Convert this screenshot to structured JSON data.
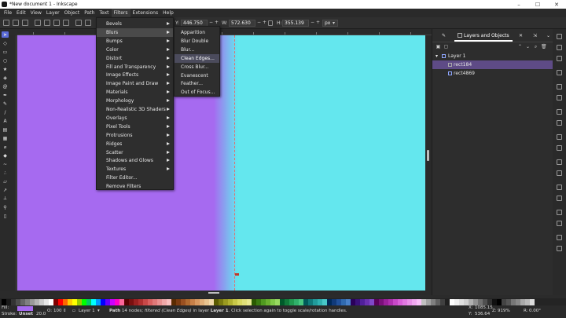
{
  "app": {
    "window_title": "*New document 1 - Inkscape",
    "window_controls": {
      "minimize": "–",
      "maximize": "☐",
      "close": "✕"
    }
  },
  "menubar": {
    "items": [
      {
        "label": "File"
      },
      {
        "label": "Edit"
      },
      {
        "label": "View"
      },
      {
        "label": "Layer"
      },
      {
        "label": "Object"
      },
      {
        "label": "Path"
      },
      {
        "label": "Text"
      },
      {
        "label": "Filters"
      },
      {
        "label": "Extensions"
      },
      {
        "label": "Help"
      }
    ]
  },
  "toolbar": {
    "y_label": "Y:",
    "y_value": "446.750",
    "w_label": "W:",
    "w_value": "572.630",
    "h_label": "H:",
    "h_value": "355.139",
    "units": "px",
    "minus": "−",
    "plus": "+"
  },
  "filters_menu": {
    "items": [
      {
        "label": "Bevels",
        "sub": true
      },
      {
        "label": "Blurs",
        "sub": true
      },
      {
        "label": "Bumps",
        "sub": true
      },
      {
        "label": "Color",
        "sub": true
      },
      {
        "label": "Distort",
        "sub": true
      },
      {
        "label": "Fill and Transparency",
        "sub": true
      },
      {
        "label": "Image Effects",
        "sub": true
      },
      {
        "label": "Image Paint and Draw",
        "sub": true
      },
      {
        "label": "Materials",
        "sub": true
      },
      {
        "label": "Morphology",
        "sub": true
      },
      {
        "label": "Non-Realistic 3D Shaders",
        "sub": true
      },
      {
        "label": "Overlays",
        "sub": true
      },
      {
        "label": "Pixel Tools",
        "sub": true
      },
      {
        "label": "Protrusions",
        "sub": true
      },
      {
        "label": "Ridges",
        "sub": true
      },
      {
        "label": "Scatter",
        "sub": true
      },
      {
        "label": "Shadows and Glows",
        "sub": true
      },
      {
        "label": "Textures",
        "sub": true
      },
      {
        "label": "Filter Editor...",
        "sub": false
      },
      {
        "label": "Remove Filters",
        "sub": false
      }
    ]
  },
  "blurs_submenu": {
    "items": [
      {
        "label": "Apparition"
      },
      {
        "label": "Blur Double"
      },
      {
        "label": "Blur..."
      },
      {
        "label": "Clean Edges..."
      },
      {
        "label": "Cross Blur..."
      },
      {
        "label": "Evanescent"
      },
      {
        "label": "Feather..."
      },
      {
        "label": "Out of Focus..."
      }
    ]
  },
  "panel": {
    "tab_label": "Layers and Objects",
    "tree": [
      {
        "label": "Layer 1"
      },
      {
        "label": "rect184"
      },
      {
        "label": "rect4869"
      }
    ]
  },
  "status": {
    "fill_label": "Fill:",
    "stroke_label": "Stroke:",
    "stroke_value": "Unset",
    "stroke_width": "20.0",
    "opacity_label": "O:",
    "opacity_value": "100",
    "layer_value": "Layer 1",
    "message_bold": "Path",
    "message_a": " 14 nodes; ",
    "message_italic": "filtered (Clean Edges)",
    "message_b": " in layer ",
    "message_layer": "Layer 1",
    "message_c": ". Click selection again to toggle scale/rotation handles.",
    "x_label": "X:",
    "x_value": "1085.15",
    "y_label": "Y:",
    "y_value": "536.64",
    "zoom_label": "Z:",
    "zoom_value": "919%",
    "rotation_label": "R:",
    "rotation_value": "0.00°"
  },
  "colors": {
    "canvas_purple": "#a66af0",
    "canvas_cyan": "#64e7ee",
    "selection": "#5e4b86",
    "accent_tool": "#5b6bd8"
  },
  "palette": [
    "#000000",
    "#1a1a1a",
    "#333333",
    "#4d4d4d",
    "#666666",
    "#808080",
    "#999999",
    "#b3b3b3",
    "#cccccc",
    "#e6e6e6",
    "#ffffff",
    "#800000",
    "#ff0000",
    "#ff6600",
    "#ffcc00",
    "#ffff00",
    "#99cc00",
    "#00ff00",
    "#00cc66",
    "#00ffff",
    "#0099ff",
    "#0000ff",
    "#6600ff",
    "#cc00ff",
    "#ff00cc",
    "#ff6699",
    "#5a0000",
    "#7a1010",
    "#9a2020",
    "#b03030",
    "#c84848",
    "#d86060",
    "#e07878",
    "#e89090",
    "#f0a8a8",
    "#f8c0c0",
    "#5a2a00",
    "#7a3a10",
    "#9a5020",
    "#b06a30",
    "#c88048",
    "#d89860",
    "#e0ae78",
    "#e8c490",
    "#f0d8a8",
    "#5a5a00",
    "#7a7a10",
    "#9a9a20",
    "#b0b030",
    "#c8c848",
    "#d8d860",
    "#e0e078",
    "#e8e890",
    "#2a5a00",
    "#3a7a10",
    "#509a20",
    "#6ab030",
    "#80c848",
    "#98d860",
    "#005a2a",
    "#107a3a",
    "#209a50",
    "#30b06a",
    "#48c880",
    "#005a5a",
    "#107a7a",
    "#209a9a",
    "#30b0b0",
    "#48c8c8",
    "#002a5a",
    "#103a7a",
    "#20509a",
    "#306ab0",
    "#4880c8",
    "#2a005a",
    "#3a107a",
    "#50209a",
    "#6a30b0",
    "#8048c8",
    "#5a005a",
    "#7a107a",
    "#9a209a",
    "#b030b0",
    "#c848c8",
    "#d860d8",
    "#e078e0",
    "#e890e8",
    "#f0a8f0",
    "#f8c0f8",
    "#c0c0c0",
    "#a0a0a0",
    "#808080",
    "#606060",
    "#404040",
    "#202020",
    "#ffffff",
    "#f0f0f0",
    "#e0e0e0",
    "#d0d0d0",
    "#b0b0b0",
    "#909090",
    "#707070",
    "#505050",
    "#303030",
    "#101010",
    "#000000",
    "#444444",
    "#555555",
    "#777777",
    "#888888",
    "#aaaaaa",
    "#bbbbbb",
    "#dddddd"
  ]
}
